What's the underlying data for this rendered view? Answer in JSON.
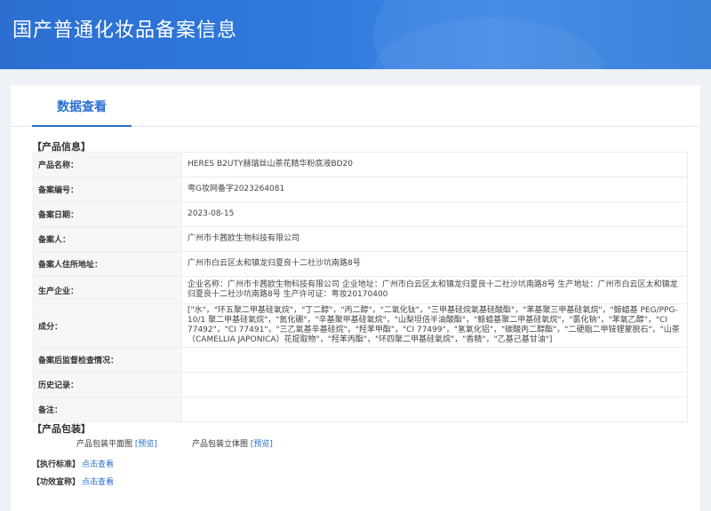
{
  "header": {
    "title": "国产普通化妆品备案信息"
  },
  "tab": {
    "label": "数据查看"
  },
  "product_info": {
    "section_title": "【产品信息】",
    "rows": [
      {
        "label": "产品名称：",
        "value": "HERES B2UTY赫瑞丝山茶花精华粉底液BD20"
      },
      {
        "label": "备案编号：",
        "value": "粤G妆网备字2023264081"
      },
      {
        "label": "备案日期：",
        "value": "2023-08-15"
      },
      {
        "label": "备案人：",
        "value": "广州市卡茜欧生物科技有限公司"
      },
      {
        "label": "备案人住所地址：",
        "value": "广州市白云区太和镇龙归夏良十二社沙坑南路8号"
      },
      {
        "label": "生产企业：",
        "value": "企业名称：广州市卡茜欧生物科技有限公司 企业地址：广州市白云区太和镇龙归夏良十二社沙坑南路8号 生产地址：广州市白云区太和镇龙归夏良十二社沙坑南路8号 生产许可证：粤妆20170400"
      },
      {
        "label": "成分：",
        "value": "[\"水\"，\"环五聚二甲基硅氧烷\"，\"丁二醇\"，\"丙二醇\"，\"二氧化钛\"，\"三甲基硅烷氧基硅酸酯\"，\"苯基聚三甲基硅氧烷\"，\"鲸蜡基 PEG/PPG-10/1 聚二甲基硅氧烷\"，\"氮化硼\"，\"辛基聚甲基硅氧烷\"，\"山梨坦倍半油酸酯\"，\"鲸蜡基聚二甲基硅氧烷\"，\"氯化钠\"，\"苯氧乙醇\"，\"CI 77492\"，\"CI 77491\"，\"三乙氧基辛基硅烷\"，\"羟苯甲酯\"，\"CI 77499\"，\"氢氧化铝\"，\"碳酸丙二醇酯\"，\"二硬脂二甲铵锂蒙脱石\"，\"山茶（CAMELLIA JAPONICA）花提取物\"，\"羟苯丙酯\"，\"环四聚二甲基硅氧烷\"，\"香精\"，\"乙基己基甘油\"]"
      },
      {
        "label": "备案后监督检查情况：",
        "value": ""
      },
      {
        "label": "历史记录：",
        "value": ""
      },
      {
        "label": "备注：",
        "value": ""
      }
    ]
  },
  "packaging": {
    "section_title": "【产品包装】",
    "flat_label": "产品包装平面图",
    "flat_link": "[预览]",
    "solid_label": "产品包装立体图",
    "solid_link": "[预览]"
  },
  "standard": {
    "label": "【执行标准】",
    "link": "点击查看"
  },
  "efficacy": {
    "label": "【功效宣称】",
    "link": "点击查看"
  }
}
